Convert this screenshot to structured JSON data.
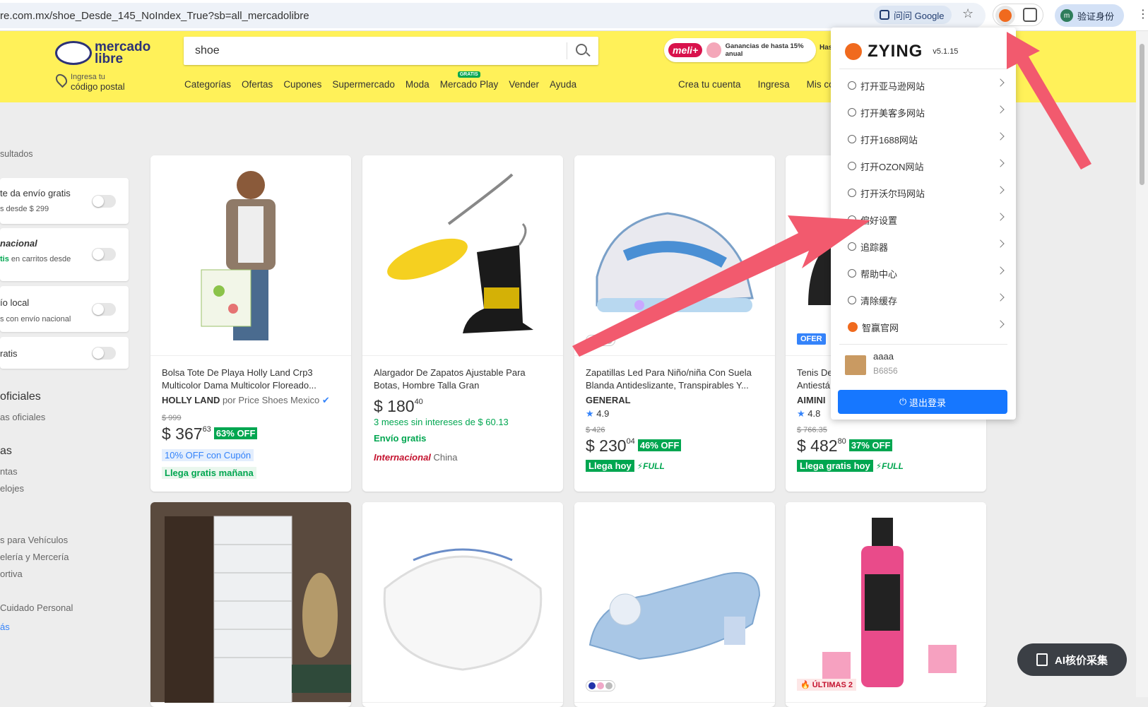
{
  "browser": {
    "url": "re.com.mx/shoe_Desde_145_NoIndex_True?sb=all_mercadolibre",
    "google_btn": "问问 Google",
    "profile_label": "验证身份"
  },
  "header": {
    "logo_line1": "mercado",
    "logo_line2": "libre",
    "location_line1": "Ingresa tu",
    "location_line2": "código postal",
    "search_value": "shoe",
    "promo_brand": "meli+",
    "promo_text": "Ganancias de hasta 15% anual",
    "promo_text2": "Has",
    "nav": [
      "Categorías",
      "Ofertas",
      "Cupones",
      "Supermercado",
      "Moda",
      "Mercado Play",
      "Vender",
      "Ayuda"
    ],
    "gratis_badge": "GRATIS",
    "account_nav": [
      "Crea tu cuenta",
      "Ingresa",
      "Mis co"
    ]
  },
  "sidebar": {
    "results": "sultados",
    "filters": [
      {
        "line1": "te da envío gratis",
        "line2": "s desde $ 299"
      },
      {
        "line1": "nacional",
        "line2_green": "tis",
        "line2": " en carritos desde"
      },
      {
        "line1": "ío local",
        "line2": "s con envío nacional"
      },
      {
        "line1": "ratis",
        "line2": ""
      }
    ],
    "section1_title": "oficiales",
    "section1_items": [
      "as oficiales"
    ],
    "section2_title": "as",
    "section2_items": [
      "ntas",
      "elojes"
    ],
    "categories": [
      "s para Vehículos",
      "elería y Mercería",
      "ortiva",
      "Cuidado Personal"
    ],
    "more": "ás"
  },
  "products": [
    {
      "title": "Bolsa Tote De Playa Holly Land Crp3 Multicolor Dama Multicolor Floreado...",
      "brand": "HOLLY LAND",
      "seller": " por Price Shoes Mexico",
      "old": "$ 999",
      "price": "$ 367",
      "cents": "63",
      "off": "63% OFF",
      "coupon": "10% OFF con Cupón",
      "ship": "Llega gratis mañana"
    },
    {
      "title": "Alargador De Zapatos Ajustable Para Botas, Hombre Talla Gran",
      "price": "$ 180",
      "cents": "40",
      "cuotas": "3 meses sin intereses de $ 60.13",
      "envio": "Envío gratis",
      "intl": "Internacional",
      "origin": " China"
    },
    {
      "title": "Zapatillas Led Para Niño/niña Con Suela Blanda Antideslizante, Transpirables Y...",
      "brand": "GENERAL",
      "rating": "4.9",
      "old": "$ 426",
      "price": "$ 230",
      "cents": "04",
      "off": "46% OFF",
      "ship": "Llega hoy",
      "full": "FULL"
    },
    {
      "title": "Tenis De",
      "title2": "Antiestá",
      "brand": "AIMINI",
      "rating": "4.8",
      "old": "$ 766.35",
      "price": "$ 482",
      "cents": "80",
      "off": "37% OFF",
      "ship": "Llega gratis hoy",
      "full": "FULL",
      "badge": "OFER"
    }
  ],
  "row2": {
    "ultimas": "ÚLTIMAS 2"
  },
  "zying": {
    "name": "ZYING",
    "version": "v5.1.15",
    "menu": [
      "打开亚马逊网站",
      "打开美客多网站",
      "打开1688网站",
      "打开OZON网站",
      "打开沃尔玛网站",
      "偏好设置",
      "追踪器",
      "帮助中心",
      "清除缓存",
      "智赢官网"
    ],
    "user_name": "aaaa",
    "user_id": "B6856",
    "logout": "退出登录"
  },
  "ai_button": "AI核价采集"
}
